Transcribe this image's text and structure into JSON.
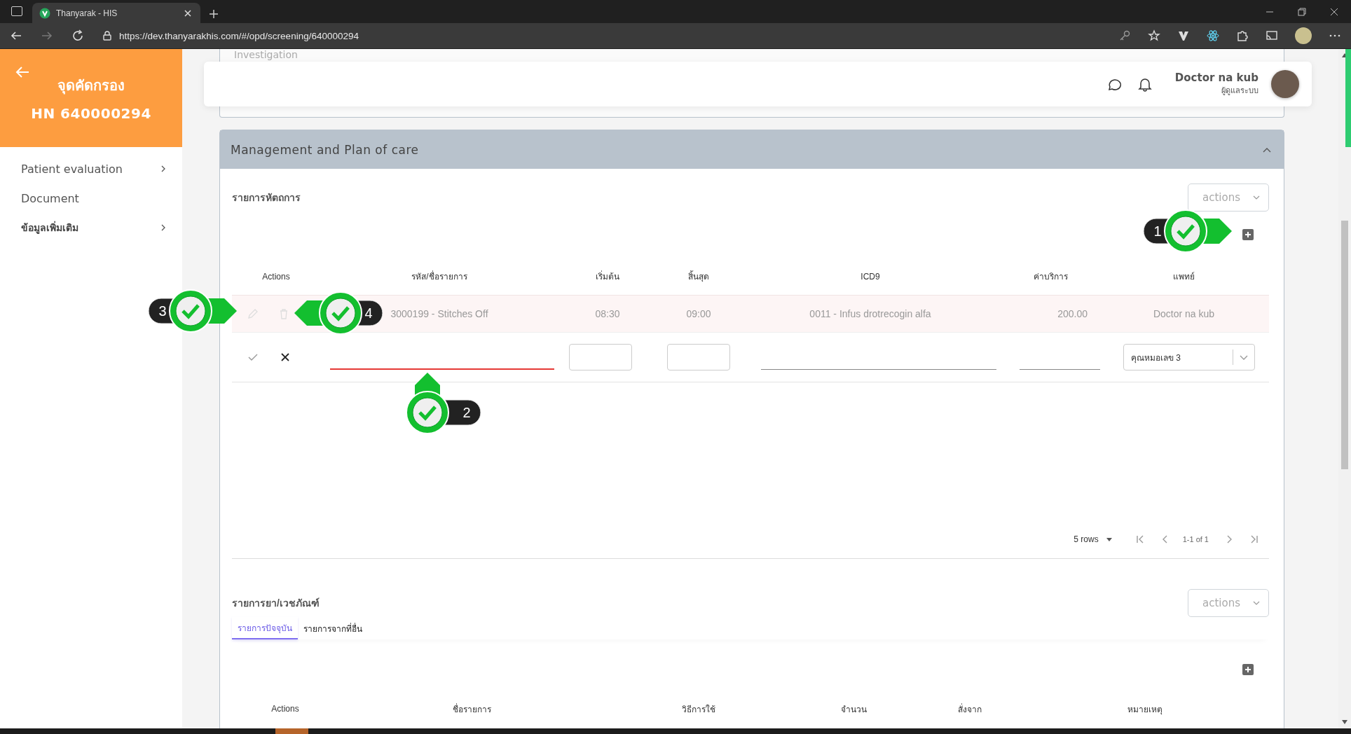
{
  "browser": {
    "tab_title": "Thanyarak - HIS",
    "url": "https://dev.thanyarakhis.com/#/opd/screening/640000294"
  },
  "sidebar": {
    "title": "จุดคัดกรอง",
    "hn": "HN 640000294",
    "items": [
      {
        "label": "Patient evaluation",
        "expandable": true,
        "bold": false
      },
      {
        "label": "Document",
        "expandable": false,
        "bold": false
      },
      {
        "label": "ข้อมูลเพิ่มเติม",
        "expandable": true,
        "bold": true
      }
    ]
  },
  "previous_section": {
    "title": "Investigation"
  },
  "header": {
    "user_name": "Doctor na kub",
    "user_role": "ผู้ดูแลระบบ"
  },
  "panel": {
    "title": "Management and Plan of care",
    "expanded": true,
    "procedures": {
      "title": "รายการหัตถการ",
      "actions_placeholder": "actions",
      "columns": [
        "Actions",
        "รหัส/ชื่อรายการ",
        "เริ่มต้น",
        "สิ้นสุด",
        "ICD9",
        "ค่าบริการ",
        "แพทย์"
      ],
      "rows": [
        {
          "disabled": true,
          "code_name": "3000199 - Stitches Off",
          "start": "08:30",
          "end": "09:00",
          "icd9": "0011 - Infus drotrecogin alfa",
          "price": "200.00",
          "doctor": "Doctor na kub"
        }
      ],
      "edit_row": {
        "code_invalid": true,
        "doctor": "คุณหมอเลข 3"
      },
      "pagination": {
        "rows": "5 rows",
        "range": "1-1 of 1"
      }
    },
    "medications": {
      "title": "รายการยา/เวชภัณฑ์",
      "actions_placeholder": "actions",
      "tabs": [
        {
          "label": "รายการปัจจุบัน",
          "selected": true
        },
        {
          "label": "รายการจากที่อื่น",
          "selected": false
        }
      ],
      "columns": [
        "Actions",
        "ชื่อรายการ",
        "วิธีการใช้",
        "จำนวน",
        "สั่งจาก",
        "หมายเหตุ"
      ]
    }
  },
  "callouts": [
    {
      "number": "1",
      "kind": "right"
    },
    {
      "number": "2",
      "kind": "up"
    },
    {
      "number": "3",
      "kind": "right"
    },
    {
      "number": "4",
      "kind": "left"
    }
  ]
}
